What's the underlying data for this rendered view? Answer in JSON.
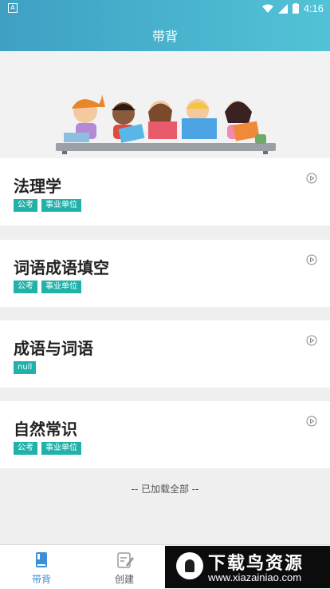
{
  "status_bar": {
    "time": "4:16",
    "left_icon": "A"
  },
  "header": {
    "title": "带背"
  },
  "items": [
    {
      "name": "法理学",
      "tags": [
        "公考",
        "事业单位"
      ]
    },
    {
      "name": "词语成语填空",
      "tags": [
        "公考",
        "事业单位"
      ]
    },
    {
      "name": "成语与词语",
      "tags": [
        "null"
      ]
    },
    {
      "name": "自然常识",
      "tags": [
        "公考",
        "事业单位"
      ]
    }
  ],
  "list_end": "-- 已加载全部 --",
  "tabs": [
    {
      "label": "带背",
      "active": true
    },
    {
      "label": "创建",
      "active": false
    }
  ],
  "watermark": {
    "line1": "下载鸟资源",
    "line2": "www.xiazainiao.com"
  },
  "colors": {
    "accent": "#20b2aa",
    "tab_active": "#3a8fd8",
    "header_start": "#3fa0c4",
    "header_end": "#52c3d6"
  }
}
